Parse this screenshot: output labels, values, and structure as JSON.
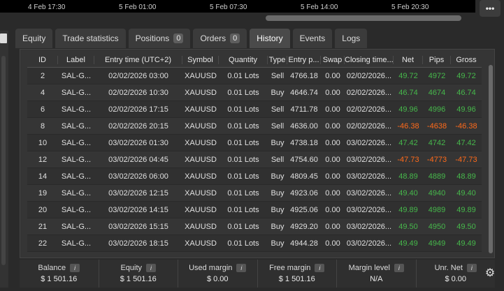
{
  "chart": {
    "times": [
      "4 Feb 17:30",
      "5 Feb 01:00",
      "5 Feb 07:30",
      "5 Feb 14:00",
      "5 Feb 20:30"
    ]
  },
  "more_button": "•••",
  "tabs": [
    {
      "label": "Equity"
    },
    {
      "label": "Trade statistics"
    },
    {
      "label": "Positions",
      "badge": "0"
    },
    {
      "label": "Orders",
      "badge": "0"
    },
    {
      "label": "History",
      "active": true
    },
    {
      "label": "Events"
    },
    {
      "label": "Logs"
    }
  ],
  "table": {
    "headers": [
      "ID",
      "Label",
      "Entry time (UTC+2)",
      "Symbol",
      "Quantity",
      "Type",
      "Entry p...",
      "Swap",
      "Closing time...",
      "Net",
      "Pips",
      "Gross"
    ],
    "rows": [
      {
        "id": "2",
        "label": "SAL-G...",
        "entry": "02/02/2026 03:00",
        "symbol": "XAUUSD",
        "qty": "0.01 Lots",
        "type": "Sell",
        "price": "4766.18",
        "swap": "0.00",
        "close": "02/02/2026...",
        "net": "49.72",
        "pips": "4972",
        "gross": "49.72",
        "sign": "pos"
      },
      {
        "id": "4",
        "label": "SAL-G...",
        "entry": "02/02/2026 10:30",
        "symbol": "XAUUSD",
        "qty": "0.01 Lots",
        "type": "Buy",
        "price": "4646.74",
        "swap": "0.00",
        "close": "02/02/2026...",
        "net": "46.74",
        "pips": "4674",
        "gross": "46.74",
        "sign": "pos"
      },
      {
        "id": "6",
        "label": "SAL-G...",
        "entry": "02/02/2026 17:15",
        "symbol": "XAUUSD",
        "qty": "0.01 Lots",
        "type": "Sell",
        "price": "4711.78",
        "swap": "0.00",
        "close": "02/02/2026...",
        "net": "49.96",
        "pips": "4996",
        "gross": "49.96",
        "sign": "pos"
      },
      {
        "id": "8",
        "label": "SAL-G...",
        "entry": "02/02/2026 20:15",
        "symbol": "XAUUSD",
        "qty": "0.01 Lots",
        "type": "Sell",
        "price": "4636.00",
        "swap": "0.00",
        "close": "02/02/2026...",
        "net": "-46.38",
        "pips": "-4638",
        "gross": "-46.38",
        "sign": "neg"
      },
      {
        "id": "10",
        "label": "SAL-G...",
        "entry": "03/02/2026 01:30",
        "symbol": "XAUUSD",
        "qty": "0.01 Lots",
        "type": "Buy",
        "price": "4738.18",
        "swap": "0.00",
        "close": "03/02/2026...",
        "net": "47.42",
        "pips": "4742",
        "gross": "47.42",
        "sign": "pos"
      },
      {
        "id": "12",
        "label": "SAL-G...",
        "entry": "03/02/2026 04:45",
        "symbol": "XAUUSD",
        "qty": "0.01 Lots",
        "type": "Sell",
        "price": "4754.60",
        "swap": "0.00",
        "close": "03/02/2026...",
        "net": "-47.73",
        "pips": "-4773",
        "gross": "-47.73",
        "sign": "neg"
      },
      {
        "id": "14",
        "label": "SAL-G...",
        "entry": "03/02/2026 06:00",
        "symbol": "XAUUSD",
        "qty": "0.01 Lots",
        "type": "Buy",
        "price": "4809.45",
        "swap": "0.00",
        "close": "03/02/2026...",
        "net": "48.89",
        "pips": "4889",
        "gross": "48.89",
        "sign": "pos"
      },
      {
        "id": "19",
        "label": "SAL-G...",
        "entry": "03/02/2026 12:15",
        "symbol": "XAUUSD",
        "qty": "0.01 Lots",
        "type": "Buy",
        "price": "4923.06",
        "swap": "0.00",
        "close": "03/02/2026...",
        "net": "49.40",
        "pips": "4940",
        "gross": "49.40",
        "sign": "pos"
      },
      {
        "id": "20",
        "label": "SAL-G...",
        "entry": "03/02/2026 14:15",
        "symbol": "XAUUSD",
        "qty": "0.01 Lots",
        "type": "Buy",
        "price": "4925.06",
        "swap": "0.00",
        "close": "03/02/2026...",
        "net": "49.89",
        "pips": "4989",
        "gross": "49.89",
        "sign": "pos"
      },
      {
        "id": "21",
        "label": "SAL-G...",
        "entry": "03/02/2026 15:15",
        "symbol": "XAUUSD",
        "qty": "0.01 Lots",
        "type": "Buy",
        "price": "4929.20",
        "swap": "0.00",
        "close": "03/02/2026...",
        "net": "49.50",
        "pips": "4950",
        "gross": "49.50",
        "sign": "pos"
      },
      {
        "id": "22",
        "label": "SAL-G...",
        "entry": "03/02/2026 18:15",
        "symbol": "XAUUSD",
        "qty": "0.01 Lots",
        "type": "Buy",
        "price": "4944.28",
        "swap": "0.00",
        "close": "03/02/2026...",
        "net": "49.49",
        "pips": "4949",
        "gross": "49.49",
        "sign": "pos"
      }
    ]
  },
  "summary": [
    {
      "label": "Balance",
      "value": "$ 1 501.16"
    },
    {
      "label": "Equity",
      "value": "$ 1 501.16"
    },
    {
      "label": "Used margin",
      "value": "$ 0.00"
    },
    {
      "label": "Free margin",
      "value": "$ 1 501.16"
    },
    {
      "label": "Margin level",
      "value": "N/A"
    },
    {
      "label": "Unr. Net",
      "value": "$ 0.00"
    }
  ],
  "colors": {
    "positive": "#46b84b",
    "negative": "#ff6a1a"
  }
}
